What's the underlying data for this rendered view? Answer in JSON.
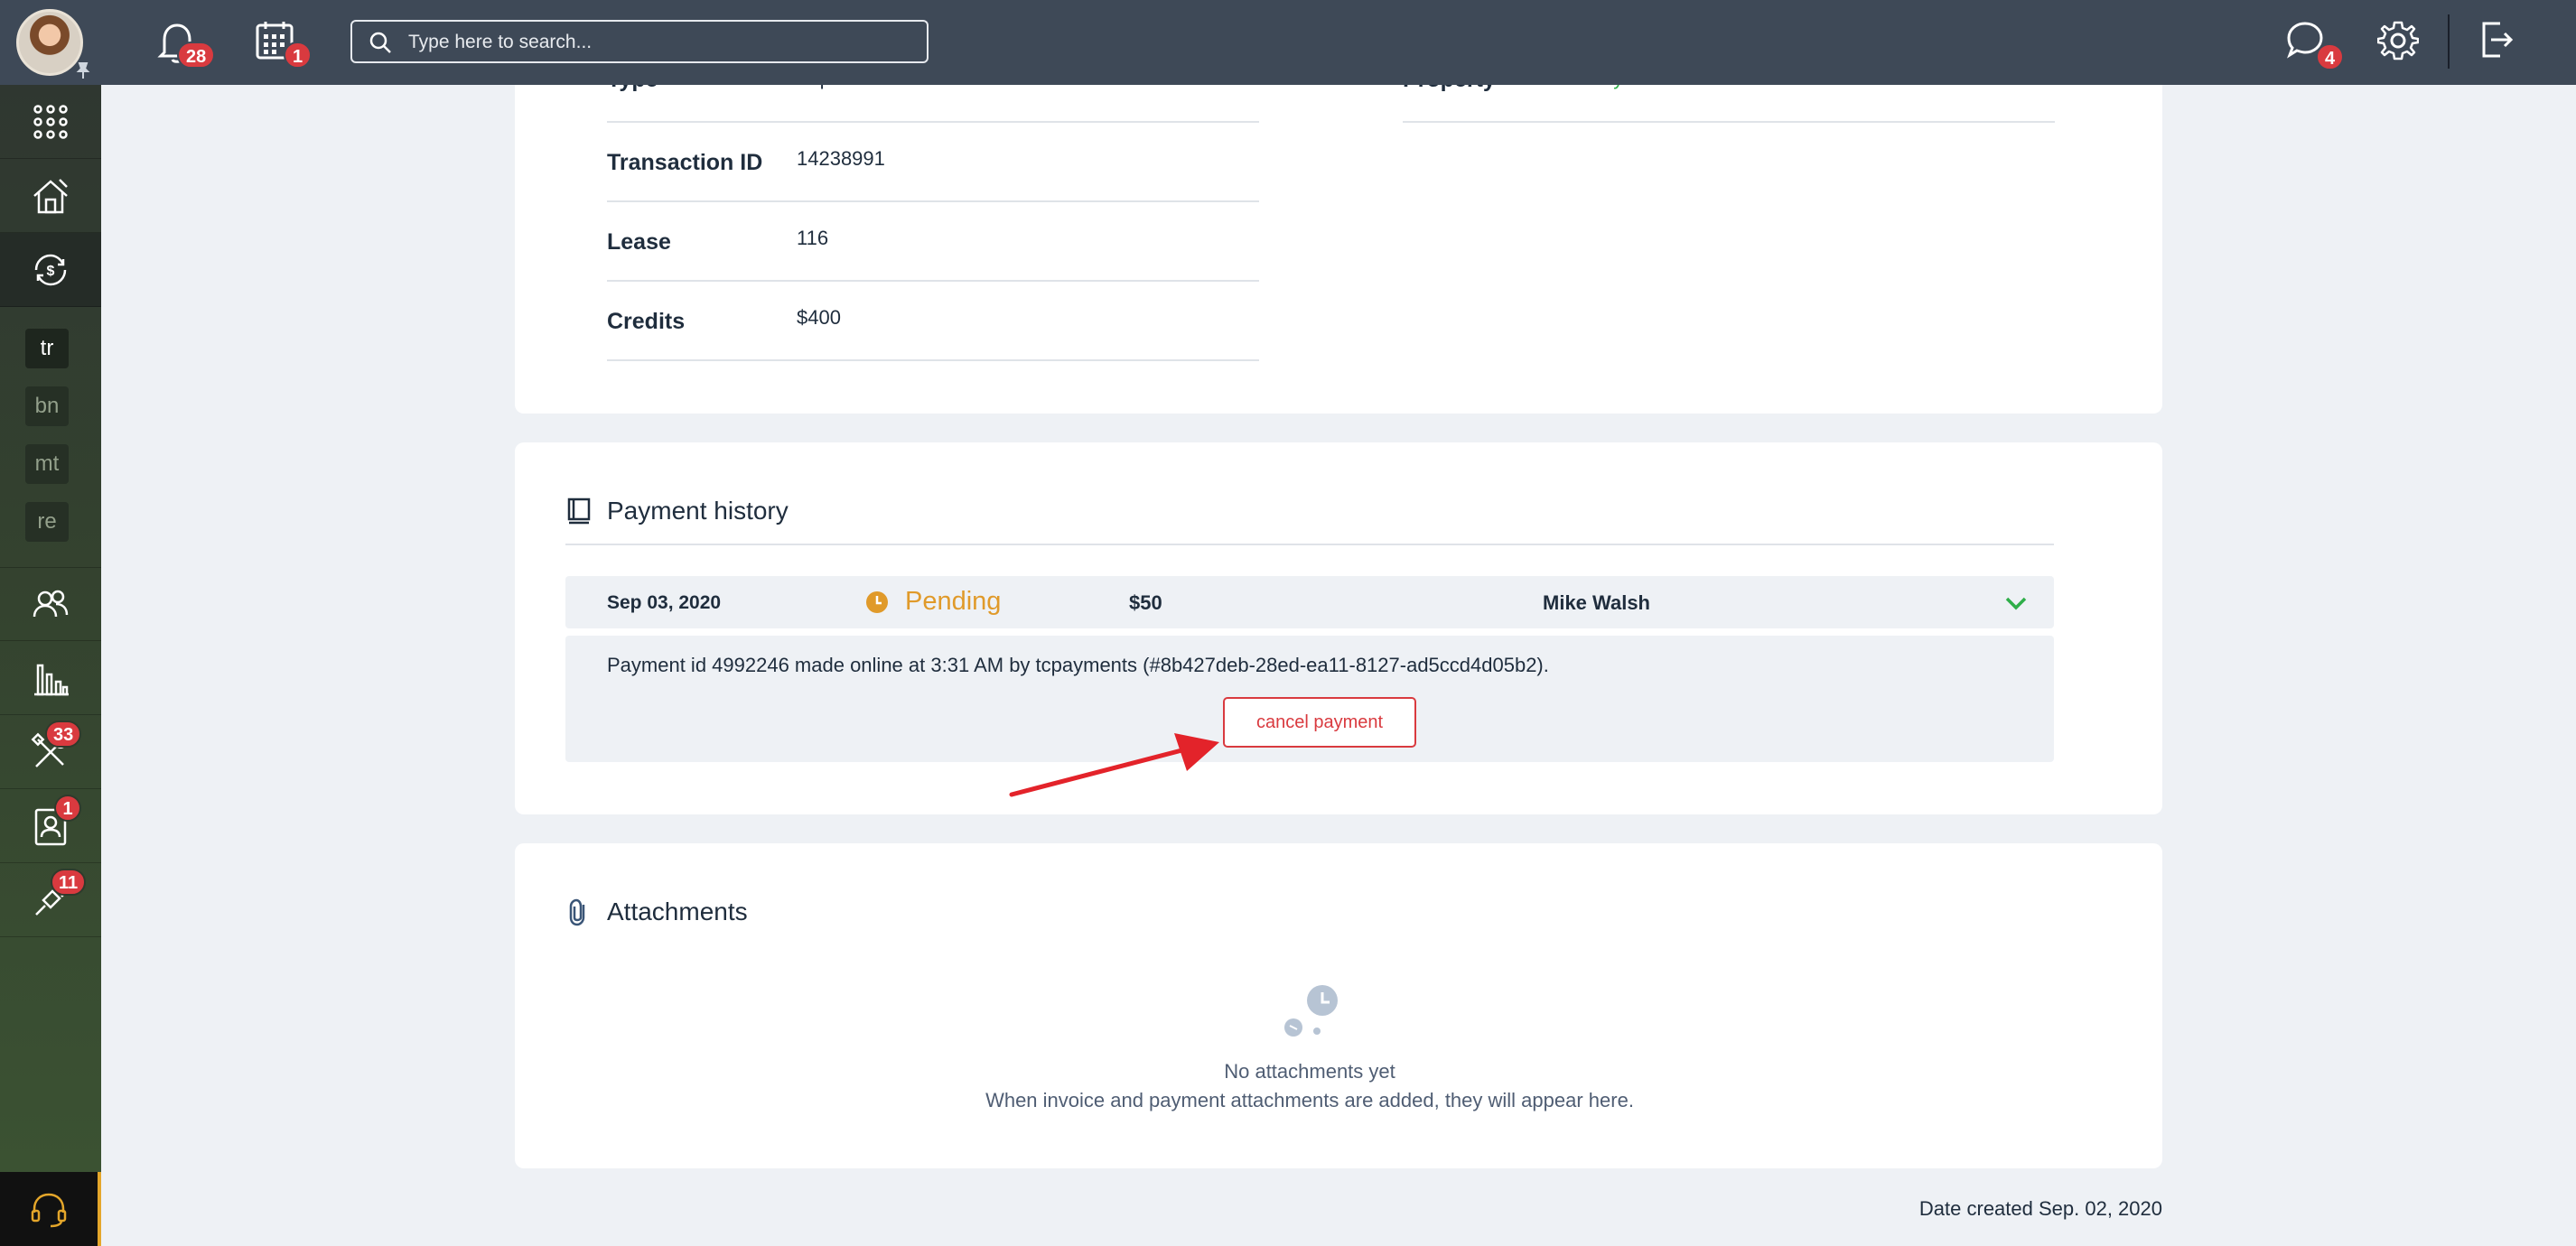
{
  "topbar": {
    "notifications_count": "28",
    "calendar_count": "1",
    "search_placeholder": "Type here to search...",
    "messages_count": "4"
  },
  "sidebar": {
    "tags": [
      "tr",
      "bn",
      "mt",
      "re"
    ],
    "maintenance_count": "33",
    "contacts_count": "1",
    "tools_count": "11"
  },
  "details": {
    "type_label": "Type",
    "type_value": "Expense / One time",
    "property_label": "Property",
    "property_value": "Crystal Castle",
    "transaction_label": "Transaction ID",
    "transaction_value": "14238991",
    "lease_label": "Lease",
    "lease_value": "116",
    "credits_label": "Credits",
    "credits_value": "$400"
  },
  "payment_history": {
    "title": "Payment history",
    "date": "Sep 03, 2020",
    "status": "Pending",
    "amount": "$50",
    "payer": "Mike Walsh",
    "description": "Payment id 4992246 made online at 3:31 AM by tcpayments (#8b427deb-28ed-ea11-8127-ad5ccd4d05b2).",
    "cancel_label": "cancel payment"
  },
  "attachments": {
    "title": "Attachments",
    "empty_title": "No attachments yet",
    "empty_subtitle": "When invoice and payment attachments are added, they will appear here."
  },
  "footer": {
    "date_created": "Date created Sep. 02, 2020"
  },
  "colors": {
    "topbar": "#3e4957",
    "accent_green": "#2fae49",
    "pending": "#e09a2a",
    "danger": "#d93a3f"
  }
}
